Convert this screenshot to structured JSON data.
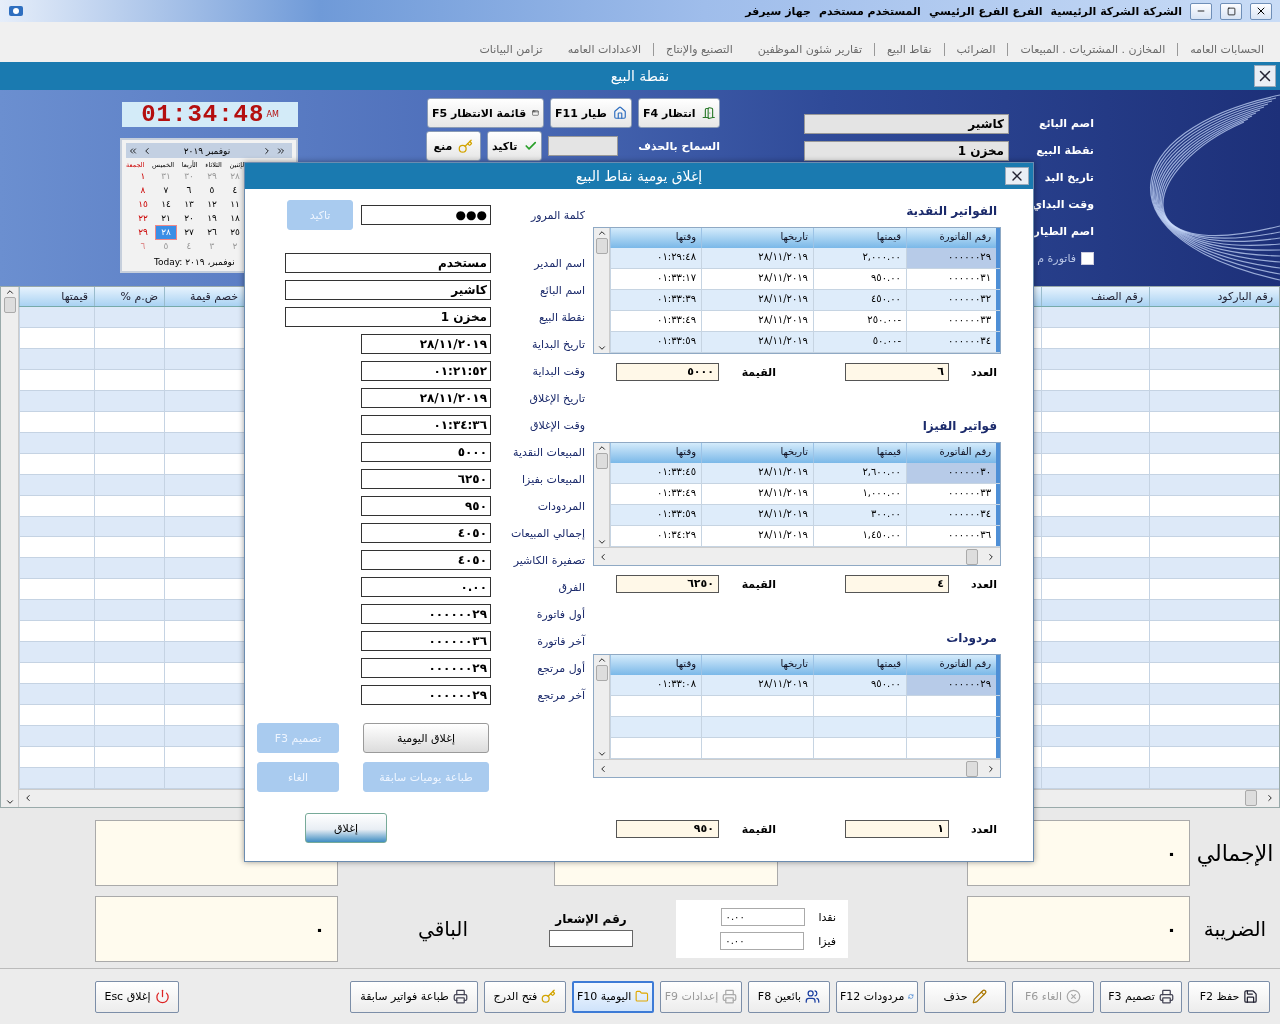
{
  "title_bar": {
    "info": [
      "الشركة الشركة الرئيسية",
      "الفرع الفرع الرئيسي",
      "المستخدم مستخدم",
      "جهاز سيرفر"
    ]
  },
  "menu": [
    {
      "label": "الحسابات العامه",
      "separator": true
    },
    {
      "label": "المخازن . المشتريات . المبيعات",
      "separator": true
    },
    {
      "label": "الضرائب",
      "separator": true
    },
    {
      "label": "نقاط البيع",
      "separator": true
    },
    {
      "label": "تقارير شئون الموظفين",
      "separator": false
    },
    {
      "label": "التصنيع والإنتاج",
      "separator": true
    },
    {
      "label": "الاعدادات العامه",
      "separator": false
    },
    {
      "label": "تزامن البيانات",
      "separator": false
    }
  ],
  "window": {
    "title": "نقطة البيع"
  },
  "clock": {
    "time": "01:34:48",
    "suffix": "AM"
  },
  "calendar": {
    "month": "نوفمبر ٢٠١٩",
    "weekdays": [
      "الإثنين",
      "الثلاثاء",
      "الأربعا",
      "الخميس",
      "الجمعة"
    ],
    "weeks": [
      [
        {
          "d": "٢٨",
          "other_month": true,
          "selected": false
        },
        {
          "d": "٢٩",
          "other_month": true,
          "selected": false
        },
        {
          "d": "٣٠",
          "other_month": true,
          "selected": false
        },
        {
          "d": "٣١",
          "other_month": true,
          "selected": false
        },
        {
          "d": "١",
          "other_month": false,
          "selected": false
        }
      ],
      [
        {
          "d": "٤",
          "other_month": false,
          "selected": false
        },
        {
          "d": "٥",
          "other_month": false,
          "selected": false
        },
        {
          "d": "٦",
          "other_month": false,
          "selected": false
        },
        {
          "d": "٧",
          "other_month": false,
          "selected": false
        },
        {
          "d": "٨",
          "other_month": false,
          "selected": false
        }
      ],
      [
        {
          "d": "١١",
          "other_month": false,
          "selected": false
        },
        {
          "d": "١٢",
          "other_month": false,
          "selected": false
        },
        {
          "d": "١٣",
          "other_month": false,
          "selected": false
        },
        {
          "d": "١٤",
          "other_month": false,
          "selected": false
        },
        {
          "d": "١٥",
          "other_month": false,
          "selected": false
        }
      ],
      [
        {
          "d": "١٨",
          "other_month": false,
          "selected": false
        },
        {
          "d": "١٩",
          "other_month": false,
          "selected": false
        },
        {
          "d": "٢٠",
          "other_month": false,
          "selected": false
        },
        {
          "d": "٢١",
          "other_month": false,
          "selected": false
        },
        {
          "d": "٢٢",
          "other_month": false,
          "selected": false
        }
      ],
      [
        {
          "d": "٢٥",
          "other_month": false,
          "selected": false
        },
        {
          "d": "٢٦",
          "other_month": false,
          "selected": false
        },
        {
          "d": "٢٧",
          "other_month": false,
          "selected": false
        },
        {
          "d": "٢٨",
          "other_month": false,
          "selected": true
        },
        {
          "d": "٢٩",
          "other_month": false,
          "selected": false
        }
      ],
      [
        {
          "d": "٢",
          "other_month": true,
          "selected": false
        },
        {
          "d": "٣",
          "other_month": true,
          "selected": false
        },
        {
          "d": "٤",
          "other_month": true,
          "selected": false
        },
        {
          "d": "٥",
          "other_month": true,
          "selected": false
        },
        {
          "d": "٦",
          "other_month": true,
          "selected": false
        }
      ]
    ],
    "today": "Today: نوفمبر، ٢٠١٩"
  },
  "top_buttons": [
    "انتظار F4",
    "طيار F11",
    "قائمة الانتظار F5"
  ],
  "delete_permission": {
    "label": "السماح بالحذف",
    "buttons": [
      "تاكيد",
      "منع"
    ]
  },
  "seller_form": {
    "fields": [
      {
        "label": "اصم البائع",
        "value": "كاشير"
      },
      {
        "label": "نقطة البيع",
        "value": "مخزن 1"
      }
    ],
    "labels": [
      "تاريخ البد",
      "وقت البداي",
      "اصم الطيار"
    ],
    "checkbox": {
      "label": "فاتورة م",
      "checked": false
    }
  },
  "items_table": {
    "columns": [
      "رقم الباركود",
      "رقم الصنف",
      "خصم قيمة",
      "ض.م %",
      "قيمتها"
    ]
  },
  "totals": {
    "total": {
      "label": "الإجمالي",
      "value": "٠"
    },
    "tax": {
      "label": "الضريبة",
      "value": "٠"
    },
    "remaining": {
      "label": "الباقي",
      "value": "٠"
    },
    "notice": {
      "label": "رقم الإشعار"
    },
    "payments": [
      {
        "label": "نقدا",
        "value": "٠.٠٠"
      },
      {
        "label": "فيزا",
        "value": "٠.٠٠"
      }
    ]
  },
  "toolbar": [
    {
      "label": "حفظ F2",
      "disabled": false,
      "selected": false
    },
    {
      "label": "تصميم F3",
      "disabled": false,
      "selected": false
    },
    {
      "label": "الغاء F6",
      "disabled": true,
      "selected": false
    },
    {
      "label": "حذف",
      "disabled": false,
      "selected": false
    },
    {
      "label": "مردودات F12",
      "disabled": false,
      "selected": false
    },
    {
      "label": "بائعين F8",
      "disabled": false,
      "selected": false
    },
    {
      "label": "إعدادات F9",
      "disabled": true,
      "selected": false
    },
    {
      "label": "اليومية F10",
      "disabled": false,
      "selected": true
    },
    {
      "label": "فتح الدرج",
      "disabled": false,
      "selected": false
    },
    {
      "label": "طباعة فواتير سابقة",
      "disabled": false,
      "selected": false
    }
  ],
  "close_button": "إغلاق Esc",
  "dialog": {
    "title": "إغلاق يومية نقاط البيع",
    "password": {
      "label": "كلمة المرور",
      "value": "●●●",
      "button": "تاكيد",
      "button_disabled": true
    },
    "fields": [
      {
        "label": "اسم المدير",
        "value": "مستخدم",
        "kind": "text"
      },
      {
        "label": "اسم البائع",
        "value": "كاشير",
        "kind": "text"
      },
      {
        "label": "نقطة البيع",
        "value": "مخزن 1",
        "kind": "text"
      },
      {
        "label": "تاريخ البداية",
        "value": "٢٨/١١/٢٠١٩",
        "kind": "number"
      },
      {
        "label": "وقت البداية",
        "value": "٠١:٢١:٥٢",
        "kind": "number"
      },
      {
        "label": "تاريخ الإغلاق",
        "value": "٢٨/١١/٢٠١٩",
        "kind": "number"
      },
      {
        "label": "وقت الإغلاق",
        "value": "٠١:٣٤:٣٦",
        "kind": "number"
      },
      {
        "label": "المبيعات النقدية",
        "value": "٥٠٠٠",
        "kind": "number"
      },
      {
        "label": "المبيعات بفيزا",
        "value": "٦٢٥٠",
        "kind": "number"
      },
      {
        "label": "المردودات",
        "value": "٩٥٠",
        "kind": "number"
      },
      {
        "label": "إجمالي المبيعات",
        "value": "٤٠٥٠",
        "kind": "number"
      },
      {
        "label": "تصفيرة الكاشير",
        "value": "٤٠٥٠",
        "kind": "number"
      },
      {
        "label": "الفرق",
        "value": "٠.٠٠",
        "kind": "number"
      },
      {
        "label": "أول فاتورة",
        "value": "٠٠٠٠٠٠٢٩",
        "kind": "number"
      },
      {
        "label": "آخر فاتورة",
        "value": "٠٠٠٠٠٠٣٦",
        "kind": "number"
      },
      {
        "label": "أول مرتجع",
        "value": "٠٠٠٠٠٠٢٩",
        "kind": "number"
      },
      {
        "label": "آخر مرتجع",
        "value": "٠٠٠٠٠٠٢٩",
        "kind": "number"
      }
    ],
    "buttons": [
      {
        "label": "إغلاق اليومية",
        "disabled": false
      },
      {
        "label": "F3 تصميم",
        "disabled": true
      },
      {
        "label": "طباعة يوميات سابقة",
        "disabled": true
      },
      {
        "label": "الغاء",
        "disabled": true
      }
    ],
    "close_label": "إغلاق",
    "sections": [
      {
        "title": "الفواتير النقدية",
        "columns": [
          "رقم الفاتورة",
          "قيمتها",
          "تاريخها",
          "وقتها"
        ],
        "hscroll": false,
        "rows": [
          {
            "cells": [
              "٠٠٠٠٠٠٢٩",
              "٢,٠٠٠.٠٠",
              "٢٨/١١/٢٠١٩",
              "٠١:٢٩:٤٨"
            ],
            "selected": true
          },
          {
            "cells": [
              "٠٠٠٠٠٠٣١",
              "٩٥٠.٠٠",
              "٢٨/١١/٢٠١٩",
              "٠١:٣٣:١٧"
            ],
            "selected": false
          },
          {
            "cells": [
              "٠٠٠٠٠٠٣٢",
              "٤٥٠.٠٠",
              "٢٨/١١/٢٠١٩",
              "٠١:٣٣:٣٩"
            ],
            "selected": false
          },
          {
            "cells": [
              "٠٠٠٠٠٠٣٣",
              "٢٥٠.٠٠-",
              "٢٨/١١/٢٠١٩",
              "٠١:٣٣:٤٩"
            ],
            "selected": false
          },
          {
            "cells": [
              "٠٠٠٠٠٠٣٤",
              "٥٠.٠٠-",
              "٢٨/١١/٢٠١٩",
              "٠١:٣٣:٥٩"
            ],
            "selected": false
          }
        ],
        "count_label": "العدد",
        "count": "٦",
        "value_label": "القيمة",
        "value": "٥٠٠٠"
      },
      {
        "title": "فواتير الفيزا",
        "columns": [
          "رقم الفاتورة",
          "قيمتها",
          "تاريخها",
          "وقتها"
        ],
        "hscroll": true,
        "rows": [
          {
            "cells": [
              "٠٠٠٠٠٠٣٠",
              "٢,٦٠٠.٠٠",
              "٢٨/١١/٢٠١٩",
              "٠١:٣٣:٤٥"
            ],
            "selected": true
          },
          {
            "cells": [
              "٠٠٠٠٠٠٣٣",
              "١,٠٠٠.٠٠",
              "٢٨/١١/٢٠١٩",
              "٠١:٣٣:٤٩"
            ],
            "selected": false
          },
          {
            "cells": [
              "٠٠٠٠٠٠٣٤",
              "٣٠٠.٠٠",
              "٢٨/١١/٢٠١٩",
              "٠١:٣٣:٥٩"
            ],
            "selected": false
          },
          {
            "cells": [
              "٠٠٠٠٠٠٣٦",
              "١,٤٥٠.٠٠",
              "٢٨/١١/٢٠١٩",
              "٠١:٣٤:٢٩"
            ],
            "selected": false
          }
        ],
        "count_label": "العدد",
        "count": "٤",
        "value_label": "القيمة",
        "value": "٦٢٥٠"
      },
      {
        "title": "مردودات",
        "columns": [
          "رقم الفاتورة",
          "قيمتها",
          "تاريخها",
          "وقتها"
        ],
        "hscroll": true,
        "rows": [
          {
            "cells": [
              "٠٠٠٠٠٠٢٩",
              "٩٥٠.٠٠",
              "٢٨/١١/٢٠١٩",
              "٠١:٣٣:٠٨"
            ],
            "selected": true
          }
        ],
        "count_label": "العدد",
        "count": "١",
        "value_label": "القيمة",
        "value": "٩٥٠"
      }
    ]
  }
}
